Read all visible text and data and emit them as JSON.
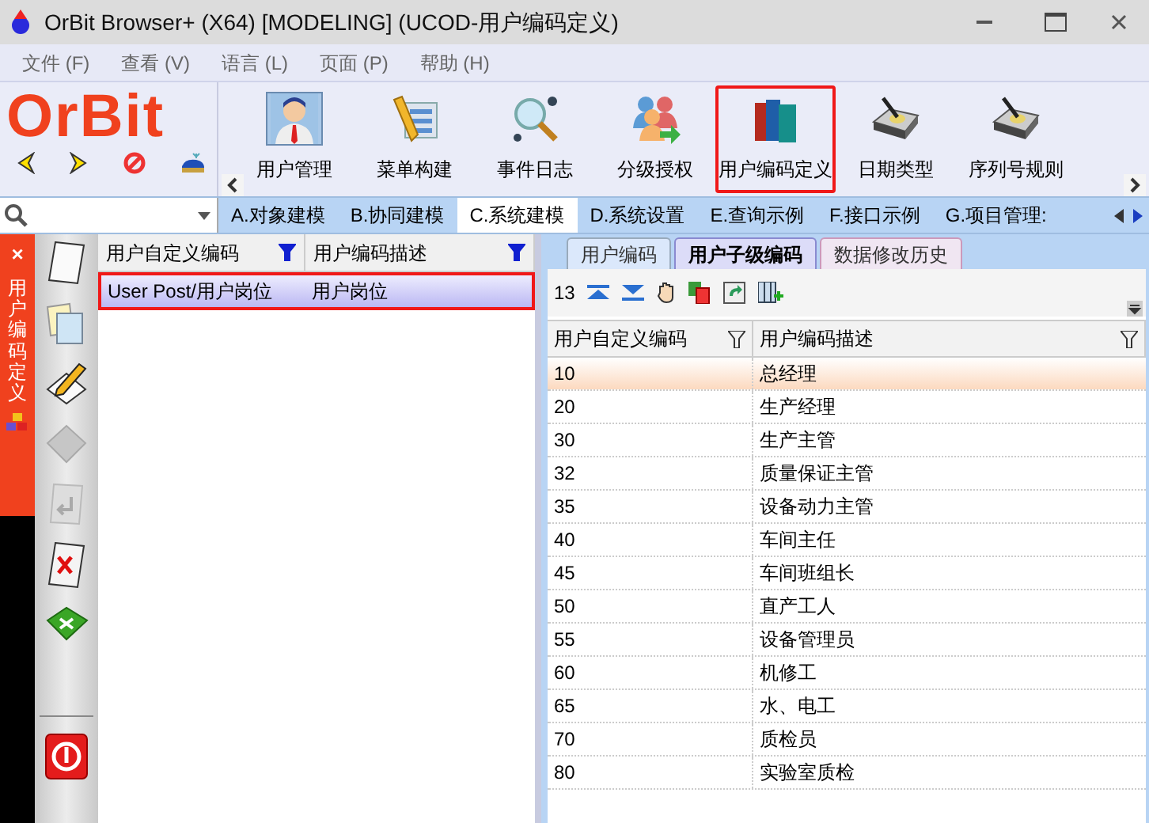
{
  "window": {
    "title": "OrBit Browser+ (X64) [MODELING] (UCOD-用户编码定义)"
  },
  "menu": [
    "文件 (F)",
    "查看 (V)",
    "语言 (L)",
    "页面 (P)",
    "帮助 (H)"
  ],
  "logo": "OrBit",
  "toolbar": [
    {
      "label": "用户管理",
      "selected": true,
      "highlighted": false,
      "kind": "person"
    },
    {
      "label": "菜单构建",
      "selected": false,
      "highlighted": false,
      "kind": "pencil"
    },
    {
      "label": "事件日志",
      "selected": false,
      "highlighted": false,
      "kind": "magnifier"
    },
    {
      "label": "分级授权",
      "selected": false,
      "highlighted": false,
      "kind": "people"
    },
    {
      "label": "用户编码定义",
      "selected": false,
      "highlighted": true,
      "kind": "books"
    },
    {
      "label": "日期类型",
      "selected": false,
      "highlighted": false,
      "kind": "drive"
    },
    {
      "label": "序列号规则",
      "selected": false,
      "highlighted": false,
      "kind": "drive"
    }
  ],
  "module_tabs": [
    {
      "label": "A.对象建模",
      "selected": false
    },
    {
      "label": "B.协同建模",
      "selected": false
    },
    {
      "label": "C.系统建模",
      "selected": true
    },
    {
      "label": "D.系统设置",
      "selected": false
    },
    {
      "label": "E.查询示例",
      "selected": false
    },
    {
      "label": "F.接口示例",
      "selected": false
    },
    {
      "label": "G.项目管理:",
      "selected": false
    }
  ],
  "side_tab": {
    "title": "用户编码定义",
    "close": "×"
  },
  "master": {
    "columns": [
      "用户自定义编码",
      "用户编码描述"
    ],
    "rows": [
      {
        "code": "User Post/用户岗位",
        "desc": "用户岗位",
        "selected": true,
        "highlighted": true
      }
    ]
  },
  "detail_tabs": [
    {
      "label": "用户编码",
      "selected": false
    },
    {
      "label": "用户子级编码",
      "selected": true
    },
    {
      "label": "数据修改历史",
      "selected": false
    }
  ],
  "detail": {
    "count": "13",
    "columns": [
      "用户自定义编码",
      "用户编码描述"
    ],
    "rows": [
      {
        "code": "10",
        "desc": "总经理",
        "selected": true
      },
      {
        "code": "20",
        "desc": "生产经理",
        "selected": false
      },
      {
        "code": "30",
        "desc": "生产主管",
        "selected": false
      },
      {
        "code": "32",
        "desc": "质量保证主管",
        "selected": false
      },
      {
        "code": "35",
        "desc": "设备动力主管",
        "selected": false
      },
      {
        "code": "40",
        "desc": "车间主任",
        "selected": false
      },
      {
        "code": "45",
        "desc": "车间班组长",
        "selected": false
      },
      {
        "code": "50",
        "desc": "直产工人",
        "selected": false
      },
      {
        "code": "55",
        "desc": "设备管理员",
        "selected": false
      },
      {
        "code": "60",
        "desc": "机修工",
        "selected": false
      },
      {
        "code": "65",
        "desc": "水、电工",
        "selected": false
      },
      {
        "code": "70",
        "desc": "质检员",
        "selected": false
      },
      {
        "code": "80",
        "desc": "实验室质检",
        "selected": false
      }
    ]
  }
}
